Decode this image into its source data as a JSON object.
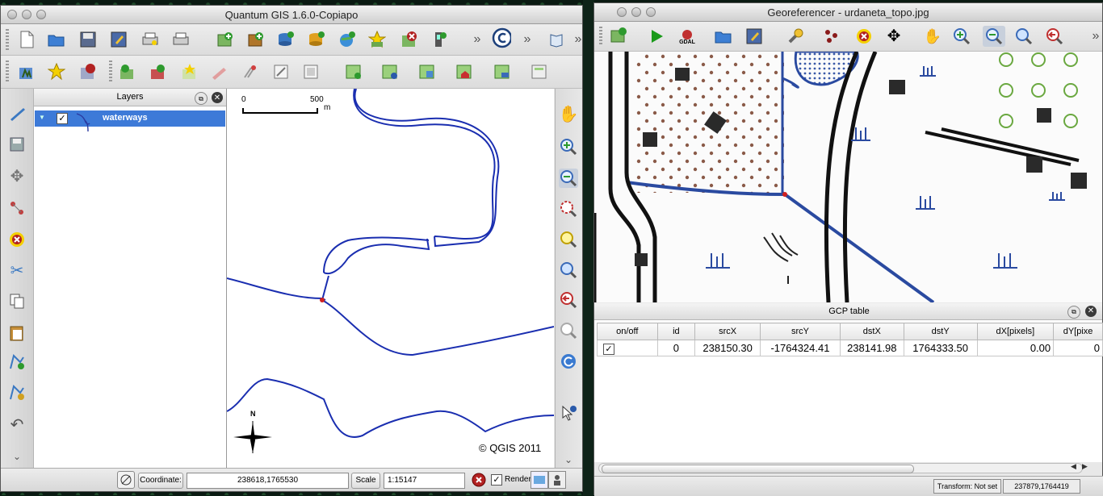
{
  "qgis": {
    "title": "Quantum GIS 1.6.0-Copiapo",
    "layers_title": "Layers",
    "layers": [
      {
        "name": "waterways",
        "checked": true
      }
    ],
    "scalebar": {
      "zero": "0",
      "five_hundred": "500",
      "unit": "m"
    },
    "north_label": "N",
    "copyright": "© QGIS 2011",
    "status": {
      "coordinate_label": "Coordinate:",
      "coordinate_value": "238618,1765530",
      "scale_label": "Scale",
      "scale_value": "1:15147",
      "render_label": "Render"
    },
    "overflow_glyph": "»"
  },
  "georef": {
    "title": "Georeferencer - urdaneta_topo.jpg",
    "gdal_label": "GDAL",
    "gcp_title": "GCP table",
    "gcp_columns": [
      "on/off",
      "id",
      "srcX",
      "srcY",
      "dstX",
      "dstY",
      "dX[pixels]",
      "dY[pixe"
    ],
    "gcp_rows": [
      {
        "checked": true,
        "id": "0",
        "srcX": "238150.30",
        "srcY": "-1764324.41",
        "dstX": "238141.98",
        "dstY": "1764333.50",
        "dX": "0.00",
        "dY": "0"
      }
    ],
    "status": {
      "transform": "Transform: Not set",
      "coord": "237879,1764419"
    }
  }
}
